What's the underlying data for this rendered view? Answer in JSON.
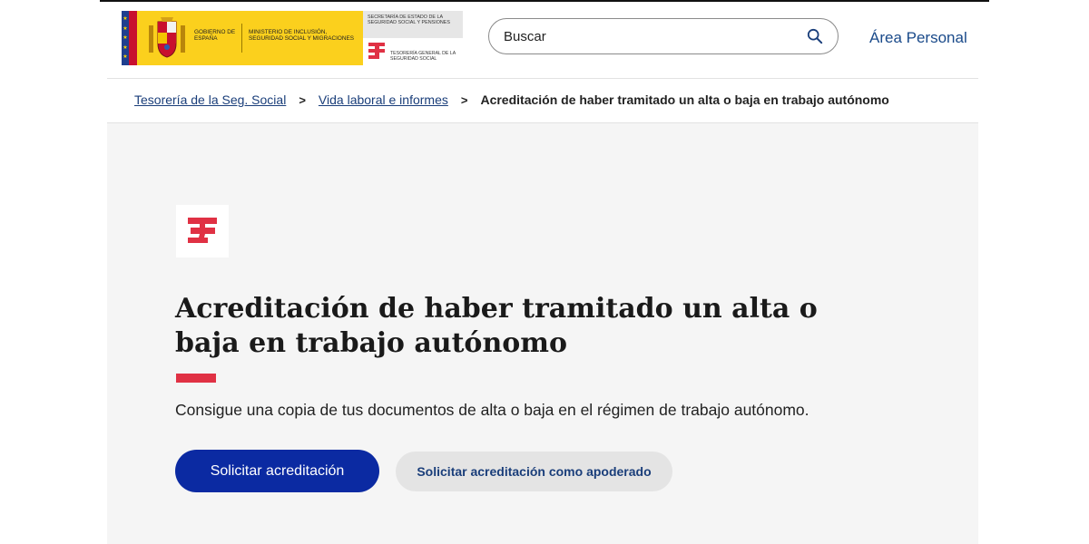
{
  "header": {
    "gov_logo": {
      "gobierno": "GOBIERNO DE ESPAÑA",
      "ministerio": "MINISTERIO DE INCLUSIÓN, SEGURIDAD SOCIAL Y MIGRACIONES",
      "secretaria": "SECRETARÍA DE ESTADO DE LA SEGURIDAD SOCIAL Y PENSIONES",
      "tesoreria": "TESORERÍA GENERAL DE LA SEGURIDAD SOCIAL"
    },
    "search": {
      "placeholder": "Buscar",
      "icon": "search-icon"
    },
    "area_personal": "Área Personal"
  },
  "breadcrumb": {
    "items": [
      "Tesorería de la Seg. Social",
      "Vida laboral e informes"
    ],
    "current": "Acreditación de haber tramitado un alta o baja en trabajo autónomo",
    "separator": ">"
  },
  "hero": {
    "icon": "tgss-logo-icon",
    "title": "Acreditación de haber tramitado un alta o baja en trabajo autónomo",
    "description": "Consigue una copia de tus documentos de alta o baja en el régimen de trabajo autónomo.",
    "primary_button": "Solicitar acreditación",
    "secondary_button": "Solicitar acreditación como apoderado"
  },
  "colors": {
    "primary": "#0b2aa2",
    "accent_red": "#e03144",
    "link": "#1a3e7a",
    "gov_yellow": "#fbd01d",
    "hero_bg": "#f5f5f5"
  }
}
